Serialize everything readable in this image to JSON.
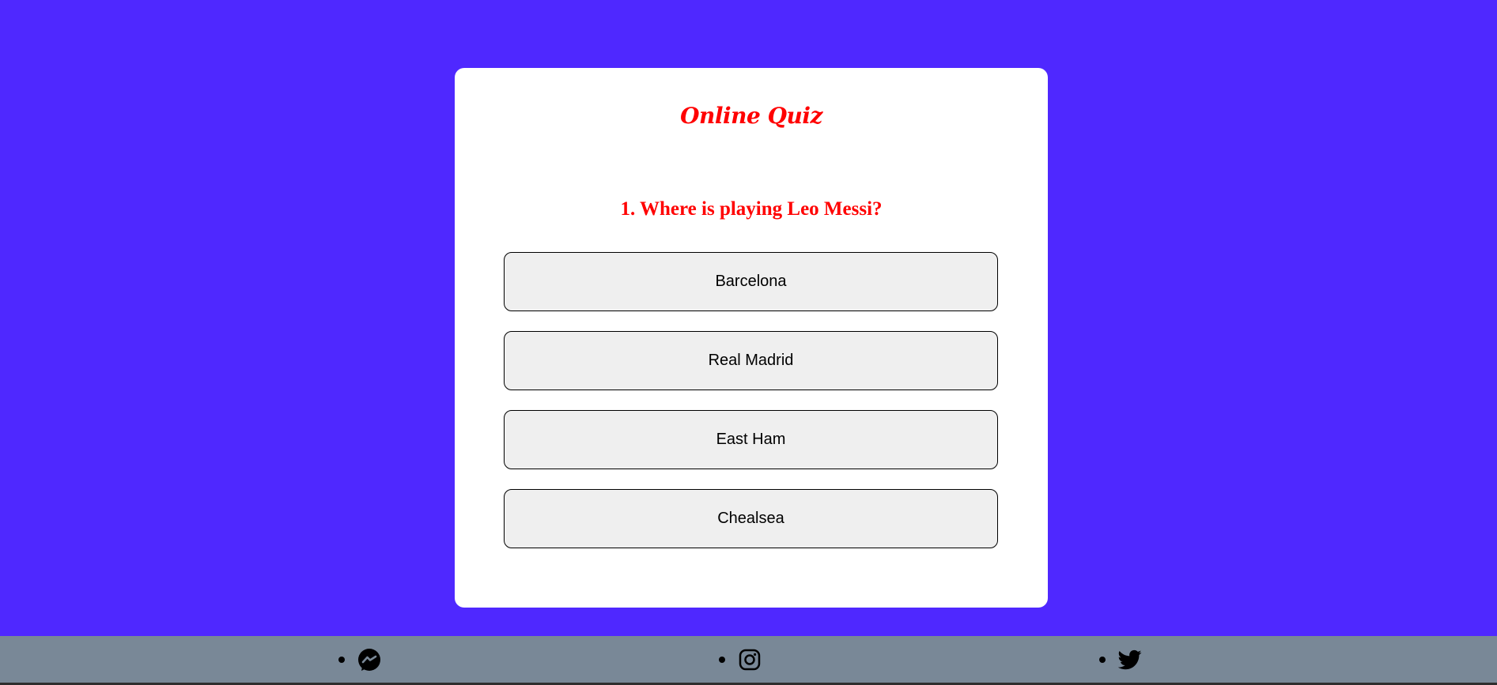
{
  "quiz": {
    "title": "Online Quiz",
    "question": "1. Where is playing Leo Messi?",
    "answers": [
      "Barcelona",
      "Real Madrid",
      "East Ham",
      "Chealsea"
    ]
  },
  "footer": {
    "icons": [
      "messenger-icon",
      "instagram-icon",
      "twitter-icon"
    ]
  },
  "colors": {
    "background": "#4f28ff",
    "accent": "#ff0000",
    "footer": "#798897",
    "answer_bg": "#efefef"
  }
}
